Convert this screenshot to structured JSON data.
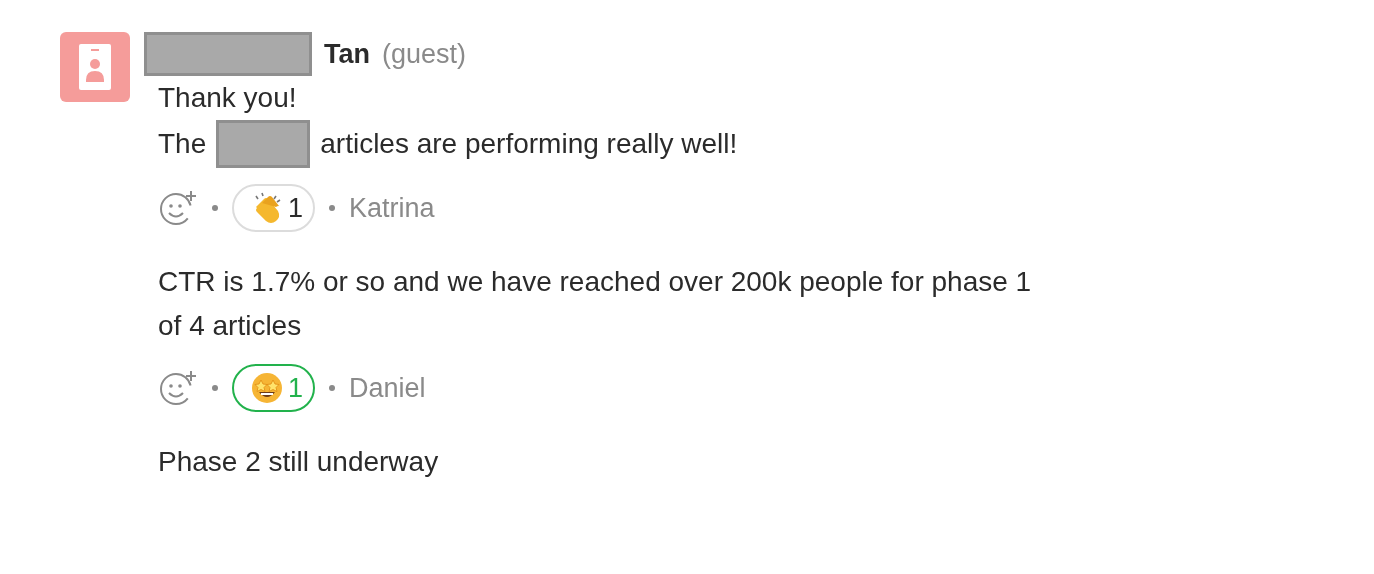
{
  "author": {
    "redacted_first_name": true,
    "name": "Tan",
    "role": "(guest)"
  },
  "items": [
    {
      "kind": "message",
      "parts": [
        {
          "kind": "text",
          "text": "Thank you!"
        }
      ]
    },
    {
      "kind": "message",
      "parts": [
        {
          "kind": "text",
          "text": "The"
        },
        {
          "kind": "redaction"
        },
        {
          "kind": "text",
          "text": "articles are performing really well!"
        }
      ]
    },
    {
      "kind": "reactions",
      "reactions": [
        {
          "kind": "clap",
          "count": "1",
          "selected": false
        }
      ],
      "reactor": "Katrina"
    },
    {
      "kind": "message",
      "parts": [
        {
          "kind": "text",
          "text": "CTR is 1.7% or so and we have reached over 200k people for phase 1 of 4 articles"
        }
      ]
    },
    {
      "kind": "reactions",
      "reactions": [
        {
          "kind": "star-struck",
          "count": "1",
          "selected": true
        }
      ],
      "reactor": "Daniel"
    },
    {
      "kind": "message",
      "parts": [
        {
          "kind": "text",
          "text": "Phase 2 still underway"
        }
      ]
    }
  ]
}
